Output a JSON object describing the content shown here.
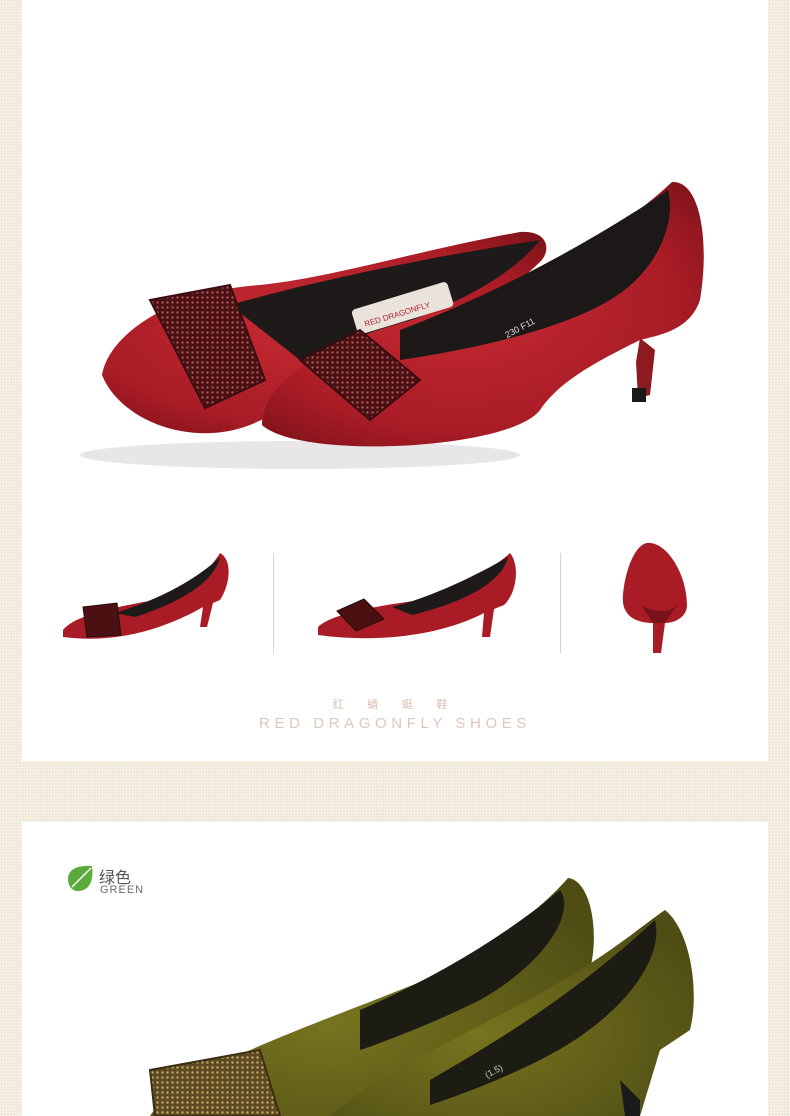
{
  "brand": {
    "name_cn": "红 蜻 蜓 鞋",
    "name_en": "RED DRAGONFLY SHOES"
  },
  "color_option": {
    "name_cn": "绿色",
    "name_en": "GREEN",
    "icon": "leaf-icon",
    "icon_color": "#5aab3c"
  },
  "product_colors": {
    "red_suede": "#b0202a",
    "olive_suede": "#6b6a1e"
  },
  "shoe_print": {
    "insole_label": "RED DRAGONFLY",
    "size_text": "230 F11",
    "code_text": "(1.5)"
  }
}
